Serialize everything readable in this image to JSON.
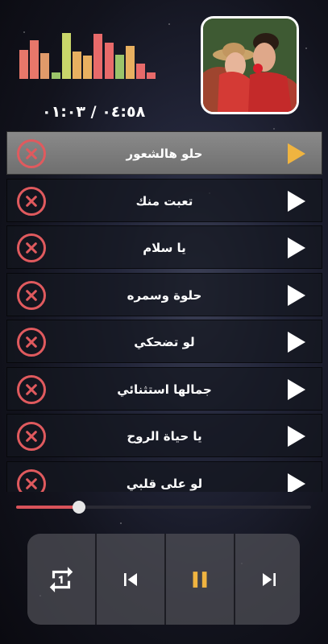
{
  "player": {
    "elapsed": "٠١:٠٣",
    "separator": "/",
    "duration": "٠٤:٥٨",
    "progress": 0.21
  },
  "equalizer": {
    "levels": [
      0.62,
      0.82,
      0.55,
      0.14,
      0.98,
      0.58,
      0.5,
      0.96,
      0.78,
      0.52,
      0.7,
      0.32,
      0.14
    ],
    "colors": [
      "#e8776a",
      "#e8776a",
      "#e09a6a",
      "#9bc46a",
      "#c9d66a",
      "#e8b060",
      "#e8b060",
      "#e86a6a",
      "#e86a6a",
      "#9bc46a",
      "#e8b060",
      "#e86a6a",
      "#e86a6a"
    ]
  },
  "playlist": {
    "active_index": 0,
    "items": [
      {
        "title": "حلو هالشعور"
      },
      {
        "title": "تعبت منك"
      },
      {
        "title": "يا سلام"
      },
      {
        "title": "حلوة وسمره"
      },
      {
        "title": "لو تضحكي"
      },
      {
        "title": "جمالها استثنائي"
      },
      {
        "title": "يا حياة الروح"
      },
      {
        "title": "لو على قلبي"
      }
    ]
  },
  "controls": {
    "repeat_icon": "repeat-one-icon",
    "prev_icon": "skip-previous-icon",
    "pause_icon": "pause-icon",
    "next_icon": "skip-next-icon",
    "accent_color": "#f0b440",
    "delete_color": "#e05a5e"
  }
}
